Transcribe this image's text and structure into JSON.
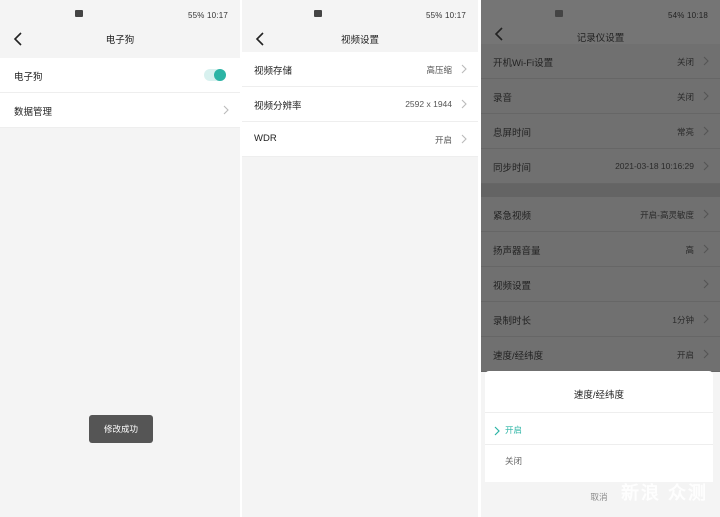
{
  "status_left": {
    "text": "55% 10:17"
  },
  "status_middle": {
    "text": "55% 10:17"
  },
  "status_right": {
    "text": "54% 10:18"
  },
  "panel1": {
    "title": "电子狗",
    "rows": [
      {
        "label": "电子狗"
      },
      {
        "label": "数据管理"
      }
    ],
    "toggle_on": true,
    "toast": "修改成功"
  },
  "panel2": {
    "title": "视频设置",
    "rows": [
      {
        "label": "视频存储",
        "value": "高压缩"
      },
      {
        "label": "视频分辨率",
        "value": "2592 x 1944"
      },
      {
        "label": "WDR",
        "value": "开启"
      }
    ]
  },
  "panel3": {
    "title": "记录仪设置",
    "rows": [
      {
        "label": "开机Wi-Fi设置",
        "value": "关闭"
      },
      {
        "label": "录音",
        "value": "关闭"
      },
      {
        "label": "息屏时间",
        "value": "常亮"
      },
      {
        "label": "同步时间",
        "value": "2021-03-18 10:16:29"
      },
      {
        "label": "紧急视频",
        "value": "开启-高灵敏度"
      },
      {
        "label": "扬声器音量",
        "value": "高"
      },
      {
        "label": "视频设置",
        "value": ""
      },
      {
        "label": "录制时长",
        "value": "1分钟"
      },
      {
        "label": "速度/经纬度",
        "value": "开启"
      }
    ]
  },
  "sheet": {
    "title": "速度/经纬度",
    "options": [
      "开启",
      "关闭"
    ],
    "selected": "开启",
    "cancel": "取消"
  },
  "watermark": "新浪 众测",
  "colors": {
    "accent": "#2cb4a5",
    "toast_bg": "#555555",
    "dim_overlay": "#707070"
  }
}
